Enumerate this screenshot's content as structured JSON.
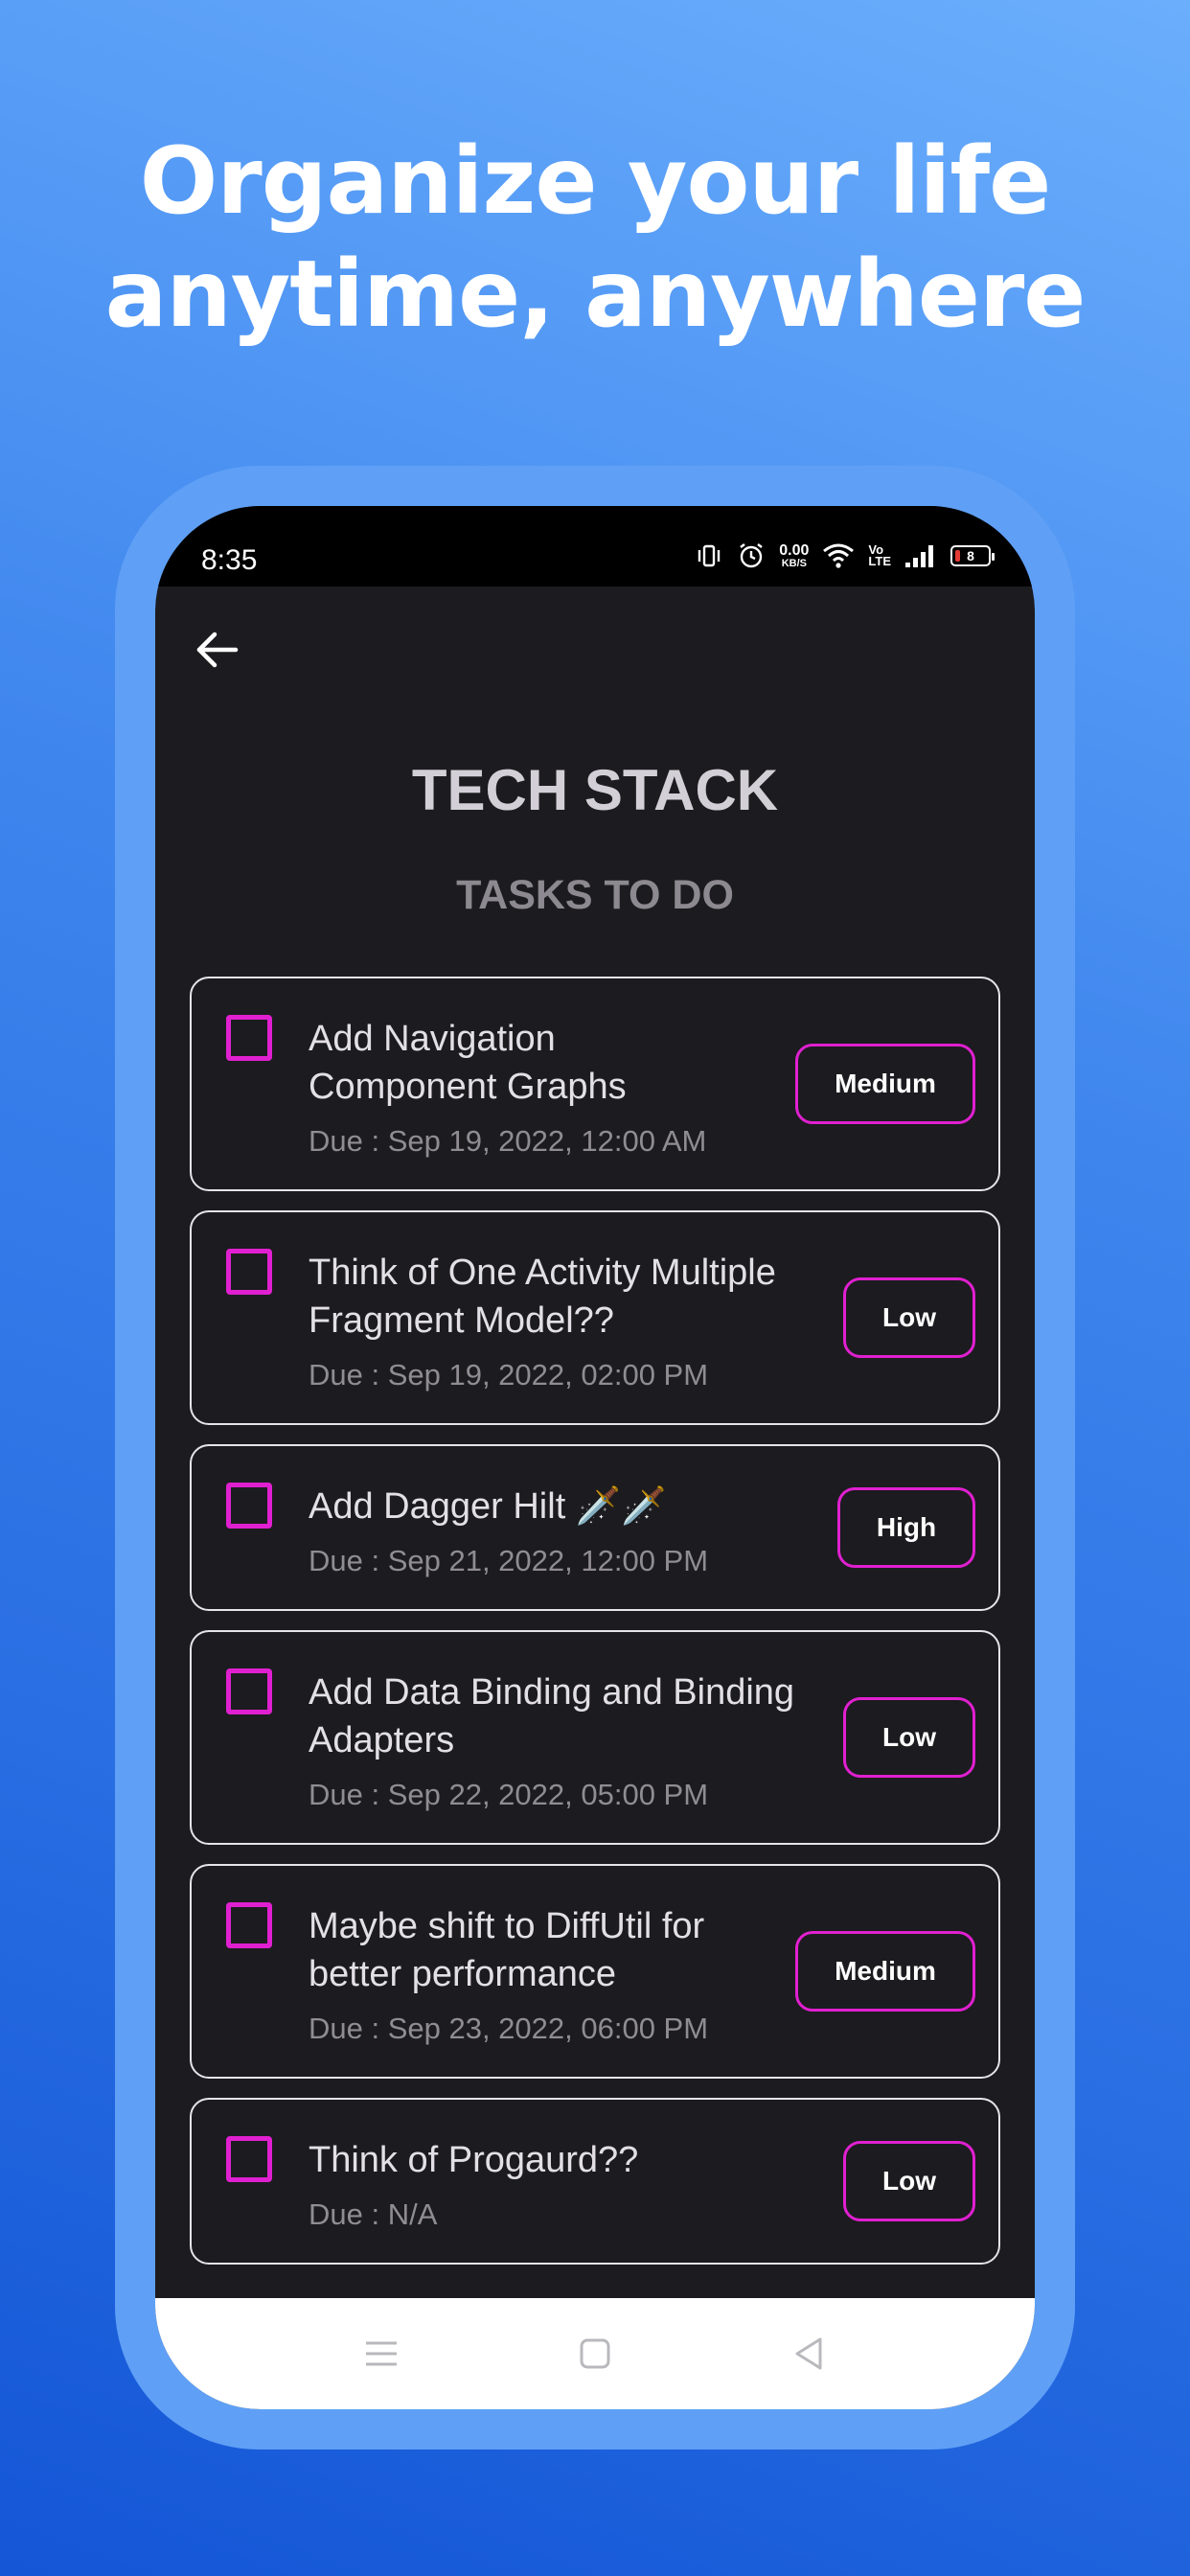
{
  "promo": {
    "headline_line1": "Organize your life",
    "headline_line2": "anytime, anywhere"
  },
  "status_bar": {
    "time": "8:35",
    "net_speed_value": "0.00",
    "net_speed_unit": "KB/S",
    "volte_top": "Vo",
    "volte_bottom": "LTE",
    "battery_level": "8",
    "icons": [
      "vibrate-icon",
      "alarm-icon",
      "wifi-icon",
      "volte-icon",
      "signal-icon",
      "battery-icon"
    ]
  },
  "header": {
    "back_icon": "arrow-left-icon",
    "title": "TECH STACK",
    "subtitle": "TASKS TO DO"
  },
  "tasks": [
    {
      "title_line1": "Add Navigation",
      "title_line2": "Component Graphs",
      "due": "Due : Sep 19, 2022, 12:00 AM",
      "priority": "Medium"
    },
    {
      "title_line1": "Think of One Activity Multiple",
      "title_line2": "Fragment Model??",
      "due": "Due : Sep 19, 2022, 02:00 PM",
      "priority": "Low"
    },
    {
      "title_line1": "Add Dagger Hilt 🗡️🗡️",
      "title_line2": "",
      "due": "Due : Sep 21, 2022, 12:00 PM",
      "priority": "High"
    },
    {
      "title_line1": "Add Data Binding and Binding",
      "title_line2": "Adapters",
      "due": "Due : Sep 22, 2022, 05:00 PM",
      "priority": "Low"
    },
    {
      "title_line1": "Maybe shift to DiffUtil for",
      "title_line2": "better performance",
      "due": "Due : Sep 23, 2022, 06:00 PM",
      "priority": "Medium"
    },
    {
      "title_line1": "Think of Progaurd??",
      "title_line2": "",
      "due": "Due : N/A",
      "priority": "Low"
    }
  ],
  "nav_bar": {
    "icons": [
      "menu-icon",
      "home-square-icon",
      "back-triangle-icon"
    ]
  },
  "colors": {
    "accent": "#e020d0",
    "background": "#1c1b1f",
    "card_border": "#e6e4ea",
    "promo_gradient_top": "#6aaefc",
    "promo_gradient_bottom": "#1456d6",
    "device_frame": "#5fa0f6"
  }
}
